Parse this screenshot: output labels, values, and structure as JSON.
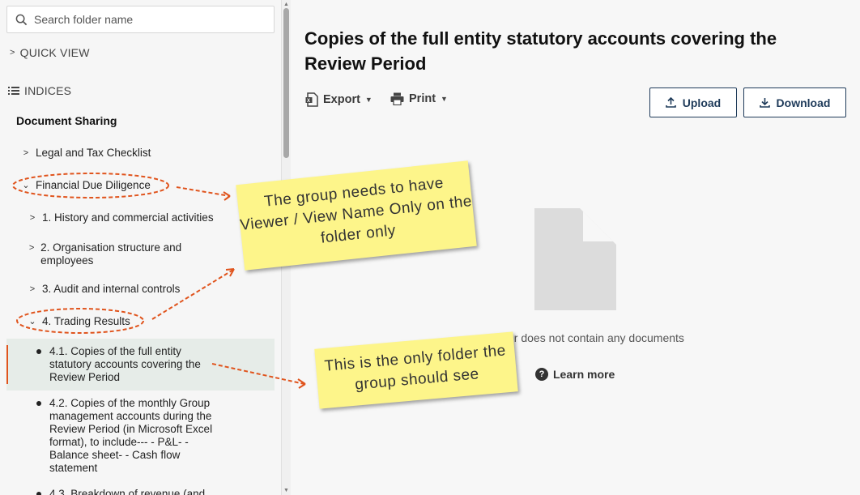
{
  "sidebar": {
    "search_placeholder": "Search folder name",
    "quick_view": "QUICK VIEW",
    "indices": "INDICES",
    "section_title": "Document Sharing",
    "items": [
      {
        "label": "Legal and Tax Checklist"
      },
      {
        "label": "Financial Due Diligence"
      },
      {
        "label": "1. History and commercial activities"
      },
      {
        "label": "2. Organisation structure and employees"
      },
      {
        "label": "3. Audit and internal controls"
      },
      {
        "label": "4. Trading Results"
      },
      {
        "label": "4.1. Copies of the full entity statutory accounts covering the Review Period"
      },
      {
        "label": "4.2. Copies of the monthly Group management accounts during the Review Period (in Microsoft Excel format), to include--- - P&L- - Balance sheet- - Cash flow statement"
      },
      {
        "label": "4.3. Breakdown of revenue (and"
      }
    ]
  },
  "main": {
    "title": "Copies of the full entity statutory accounts covering the Review Period",
    "toolbar": {
      "export_label": "Export",
      "print_label": "Print",
      "upload_label": "Upload",
      "download_label": "Download"
    },
    "empty_message": "er does not contain any documents",
    "learn_more": "Learn more"
  },
  "annotations": {
    "note1": "The group needs to have Viewer / View Name Only on the folder only",
    "note2": "This is the only folder the group should see"
  },
  "colors": {
    "accent": "#e0541d",
    "button_border": "#1f3b5a",
    "selected_bg": "#e6ece8",
    "sticky": "#fdf58a"
  }
}
